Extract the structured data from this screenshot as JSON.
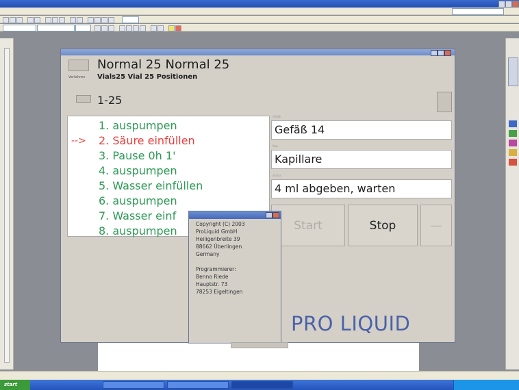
{
  "app": {
    "header": {
      "mode": "Normal 25  Normal 25",
      "subtitle": "Vials25  Vial 25 Positionen",
      "subtitle_tag": "Verfahren"
    },
    "range": {
      "value": "1-25"
    },
    "steps": [
      {
        "text": "1. auspumpen",
        "state": "done"
      },
      {
        "text": "2. Säure einfüllen",
        "state": "active"
      },
      {
        "text": "3. Pause 0h 1'",
        "state": "pending"
      },
      {
        "text": "4. auspumpen",
        "state": "pending"
      },
      {
        "text": "5. Wasser einfüllen",
        "state": "pending"
      },
      {
        "text": "6. auspumpen",
        "state": "pending"
      },
      {
        "text": "7. Wasser einf",
        "state": "pending"
      },
      {
        "text": "8. auspumpen",
        "state": "pending"
      }
    ],
    "active_marker": "-->",
    "fields": {
      "vessel": "Gefäß 14",
      "vessel_tag": "Gefäß",
      "capillary": "Kapillare",
      "capillary_tag": "Kap.",
      "status": "4 ml abgeben, warten",
      "status_tag": "Status"
    },
    "buttons": {
      "start": "Start",
      "stop": "Stop",
      "extra": "—"
    },
    "brand": "PRO LIQUID"
  },
  "about": {
    "text": "Copyright (C) 2003\nProLiquid GmbH\nHeiligenbreite 39\n88662 Überlingen\nGermany\n\nProgrammierer:\nBenno Riede\nHauptstr. 73\n78253 Eigeltingen"
  },
  "colors": {
    "done": "#2d9a55",
    "active": "#e8403e",
    "brand": "#4a62a8"
  },
  "taskbar": {
    "start_label": "start"
  }
}
